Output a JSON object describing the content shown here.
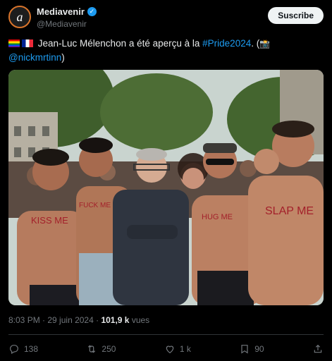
{
  "account": {
    "display_name": "Mediavenir",
    "handle": "@Mediavenir",
    "avatar_letter": "a",
    "verified_mark": "✓"
  },
  "subscribe_label": "Suscribe",
  "tweet": {
    "flags": [
      "rainbow-flag",
      "france-flag"
    ],
    "text_main": " Jean-Luc Mélenchon a été aperçu à la ",
    "hashtag": "#Pride2024",
    "text_after_hashtag": ". (",
    "camera_emoji": "📸",
    "mention": "@nickmrtinn",
    "text_end": ")"
  },
  "photo": {
    "writing_left": "KISS ME",
    "writing_second": "FUCK ME 300€",
    "writing_right_center": "HUG ME",
    "writing_right": "SLAP ME"
  },
  "meta": {
    "time": "8:03 PM",
    "separator": " · ",
    "date": "29 juin 2024",
    "views_count": "101,9 k",
    "views_label": " vues"
  },
  "actions": {
    "replies": "138",
    "reposts": "250",
    "likes": "1 k",
    "bookmarks": "90"
  },
  "icons": {
    "reply": "reply-icon",
    "repost": "repost-icon",
    "like": "heart-icon",
    "bookmark": "bookmark-icon",
    "share": "share-icon"
  },
  "colors": {
    "accent": "#1d9bf0",
    "background": "#000000",
    "muted": "#71767b"
  }
}
